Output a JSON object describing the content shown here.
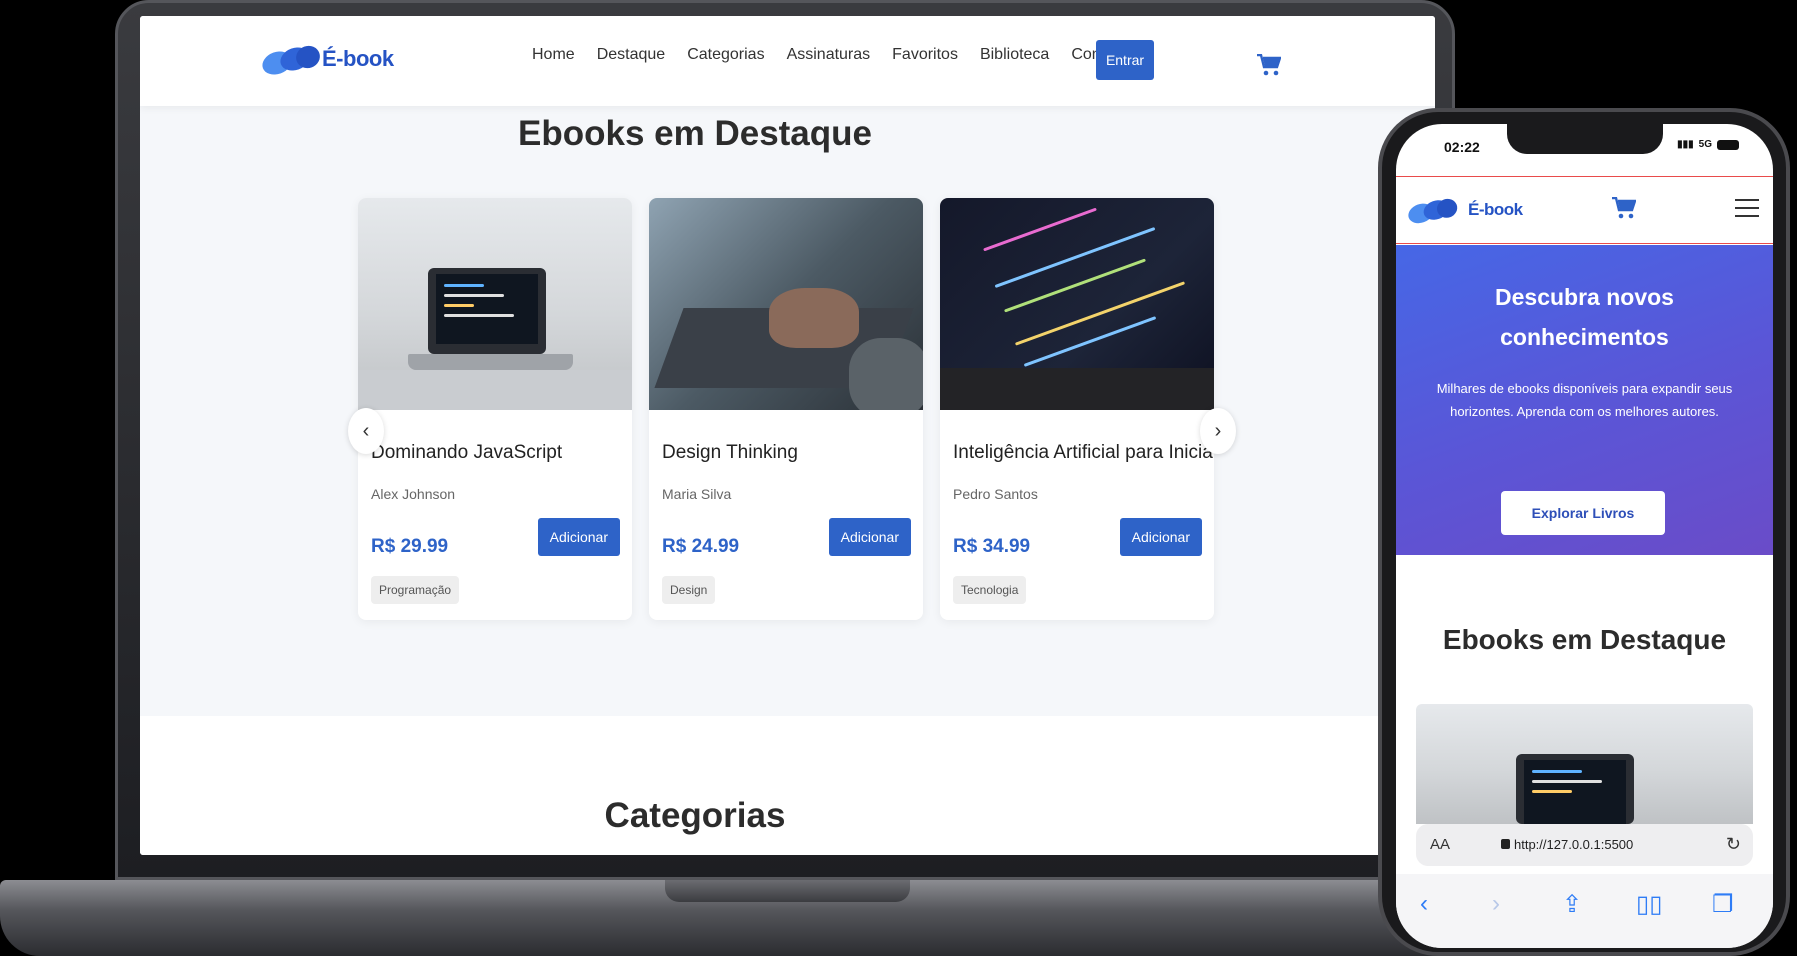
{
  "brand": {
    "name": "É-book",
    "primary": "#2e63c8"
  },
  "desktop": {
    "nav": [
      "Home",
      "Destaque",
      "Categorias",
      "Assinaturas",
      "Favoritos",
      "Biblioteca",
      "Contato"
    ],
    "login_label": "Entrar",
    "featured_title": "Ebooks em Destaque",
    "categories_title": "Categorias",
    "carousel_prev": "‹",
    "carousel_next": "›",
    "books": [
      {
        "title": "Dominando JavaScript",
        "author": "Alex Johnson",
        "price": "R$ 29.99",
        "button": "Adicionar",
        "tag": "Programação"
      },
      {
        "title": "Design Thinking",
        "author": "Maria Silva",
        "price": "R$ 24.99",
        "button": "Adicionar",
        "tag": "Design"
      },
      {
        "title": "Inteligência Artificial para Iniciantes",
        "author": "Pedro Santos",
        "price": "R$ 34.99",
        "button": "Adicionar",
        "tag": "Tecnologia"
      }
    ]
  },
  "mobile": {
    "time": "02:22",
    "network": "5G",
    "hero_title": "Descubra novos conhecimentos",
    "hero_text": "Milhares de ebooks disponíveis para expandir seus horizontes. Aprenda com os melhores autores.",
    "hero_button": "Explorar Livros",
    "featured_title": "Ebooks em Destaque",
    "address_bar": {
      "aa": "AA",
      "url": "http://127.0.0.1:5500"
    }
  }
}
